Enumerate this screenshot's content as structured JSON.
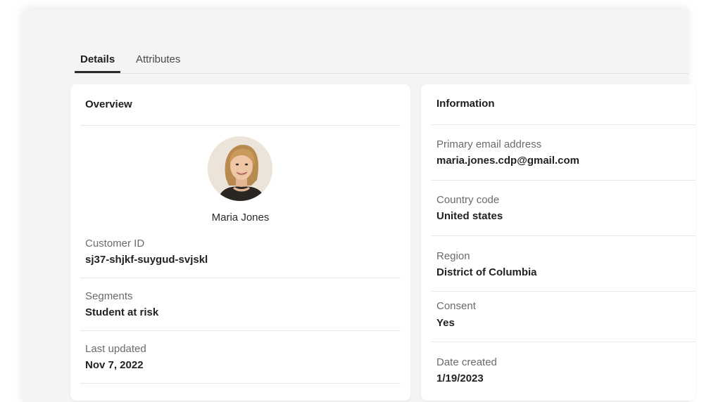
{
  "tabs": [
    {
      "label": "Details",
      "active": true
    },
    {
      "label": "Attributes",
      "active": false
    }
  ],
  "overview": {
    "title": "Overview",
    "avatar_icon": "user-avatar-photo",
    "name": "Maria Jones",
    "fields": [
      {
        "label": "Customer ID",
        "value": "sj37-shjkf-suygud-svjskl"
      },
      {
        "label": "Segments",
        "value": "Student at risk"
      },
      {
        "label": "Last updated",
        "value": "Nov 7, 2022"
      }
    ]
  },
  "information": {
    "title": "Information",
    "fields": [
      {
        "label": "Primary email address",
        "value": "maria.jones.cdp@gmail.com"
      },
      {
        "label": "Country code",
        "value": "United states"
      },
      {
        "label": "Region",
        "value": "District of Columbia"
      },
      {
        "label": "Consent",
        "value": "Yes"
      },
      {
        "label": "Date created",
        "value": "1/19/2023"
      }
    ]
  },
  "colors": {
    "page_background": "#f4f4f4",
    "card_background": "#ffffff",
    "text_primary": "#222222",
    "text_secondary": "#6b6b6b",
    "tab_indicator": "#2b2b2b"
  }
}
